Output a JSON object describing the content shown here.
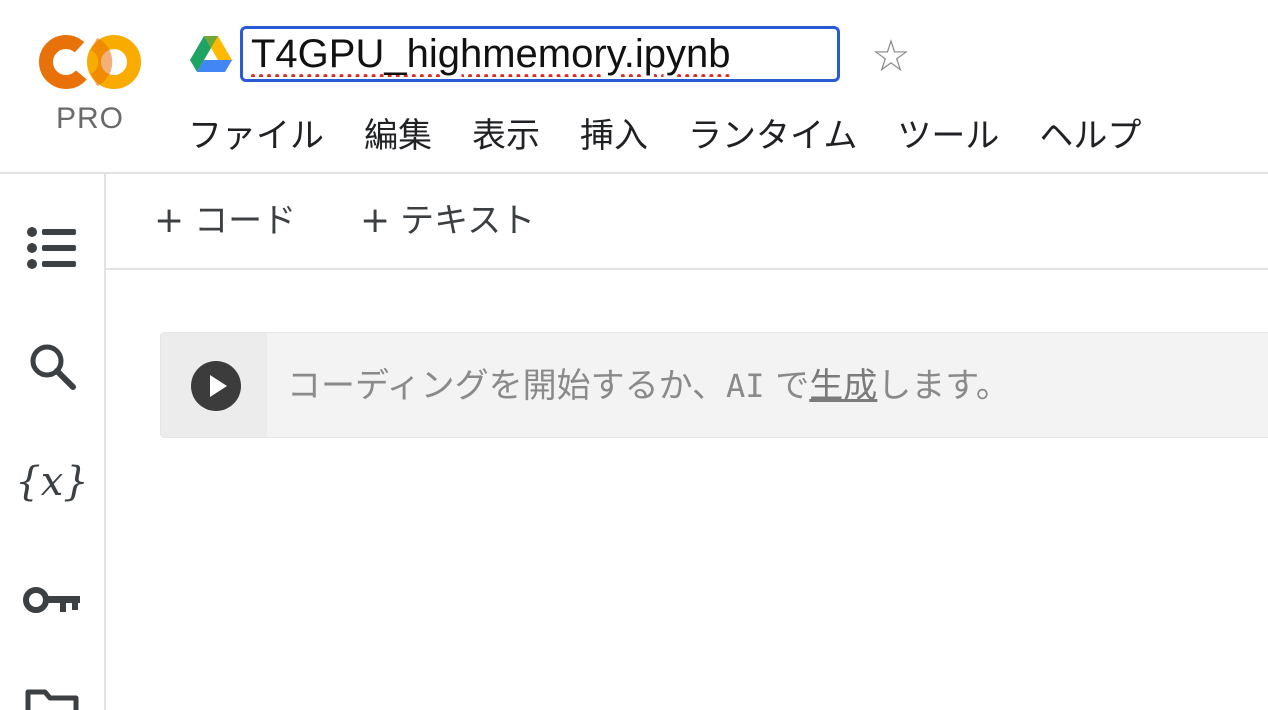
{
  "header": {
    "logo_badge": "PRO",
    "notebook_title": "T4GPU_highmemory.ipynb"
  },
  "menu": {
    "items": [
      "ファイル",
      "編集",
      "表示",
      "挿入",
      "ランタイム",
      "ツール",
      "ヘルプ"
    ]
  },
  "toolbar": {
    "add_code": "コード",
    "add_text": "テキスト",
    "plus": "+"
  },
  "rail": {
    "icons": [
      "table-of-contents-icon",
      "search-icon",
      "variables-icon",
      "key-icon",
      "folder-icon"
    ],
    "variables_glyph": "{x}"
  },
  "cell": {
    "placeholder_before": "コーディングを開始するか、",
    "placeholder_ai": "AI",
    "placeholder_mid": " で",
    "placeholder_link": "生成",
    "placeholder_after": "します。"
  },
  "colors": {
    "logo_orange": "#F9AB00",
    "logo_dark_orange": "#E8710A",
    "focus_blue": "#2A5BD7",
    "drive_green": "#1EA362",
    "drive_yellow": "#FFBA00",
    "drive_blue": "#4285F4"
  }
}
